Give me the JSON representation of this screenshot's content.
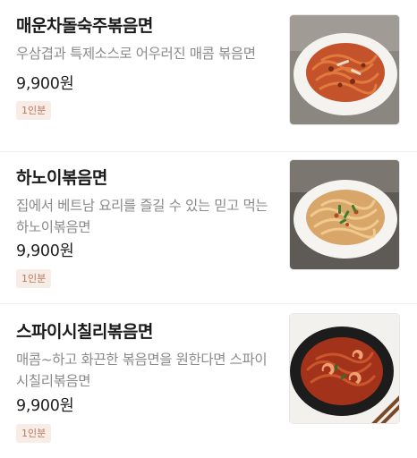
{
  "menu": {
    "items": [
      {
        "name": "매운차돌숙주볶음면",
        "description": "우삼겹과 특제소스로 어우러진 매콤 볶음면",
        "price": "9,900원",
        "badge": "1인분",
        "image_icon": "food-photo-spicy-noodles"
      },
      {
        "name": "하노이볶음면",
        "description": "집에서 베트남 요리를 즐길 수 있는 믿고 먹는 하노이볶음면",
        "price": "9,900원",
        "badge": "1인분",
        "image_icon": "food-photo-hanoi-noodles"
      },
      {
        "name": "스파이시칠리볶음면",
        "description": "매콤~하고 화끈한 볶음면을 원한다면 스파이시칠리볶음면",
        "price": "9,900원",
        "badge": "1인분",
        "image_icon": "food-photo-chili-noodles"
      }
    ]
  },
  "colors": {
    "badge_bg": "#f7ece6",
    "badge_text": "#b87a5c",
    "description_text": "#8a8a8a"
  }
}
